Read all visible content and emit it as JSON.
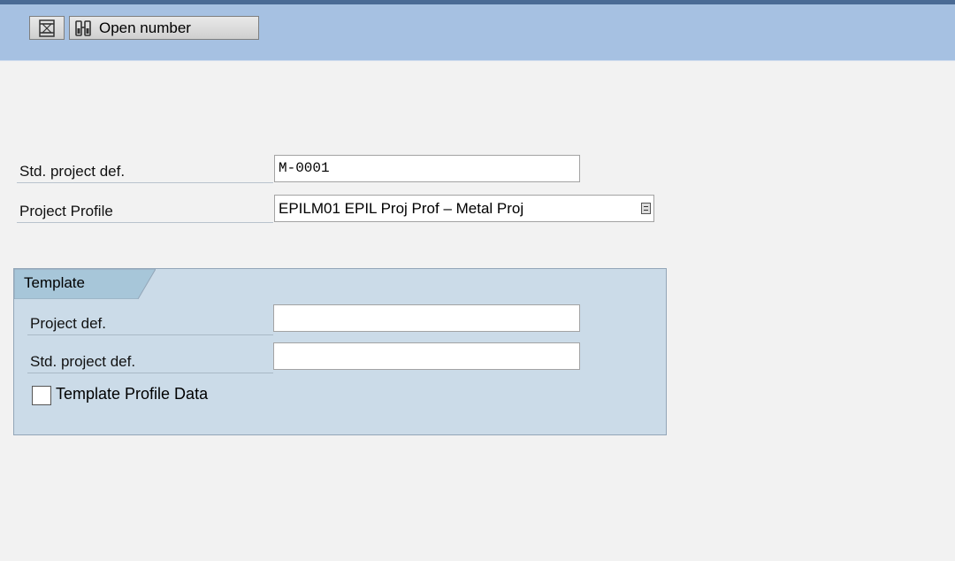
{
  "toolbar": {
    "icon_button": "hourglass-icon",
    "open_number_label": "Open number",
    "open_number_icon": "binoculars-icon"
  },
  "form": {
    "std_project_def": {
      "label": "Std. project def.",
      "value": "M-0001"
    },
    "project_profile": {
      "label": "Project Profile",
      "value": "EPILM01 EPIL Proj Prof – Metal Proj"
    }
  },
  "template": {
    "title": "Template",
    "project_def": {
      "label": "Project def.",
      "value": ""
    },
    "std_project_def": {
      "label": "Std. project def.",
      "value": ""
    },
    "profile_data": {
      "label": "Template Profile Data",
      "checked": false
    }
  },
  "colors": {
    "toolbar_bg": "#a6c1e2",
    "group_bg": "#cbdbe8",
    "page_bg": "#f2f2f2"
  }
}
